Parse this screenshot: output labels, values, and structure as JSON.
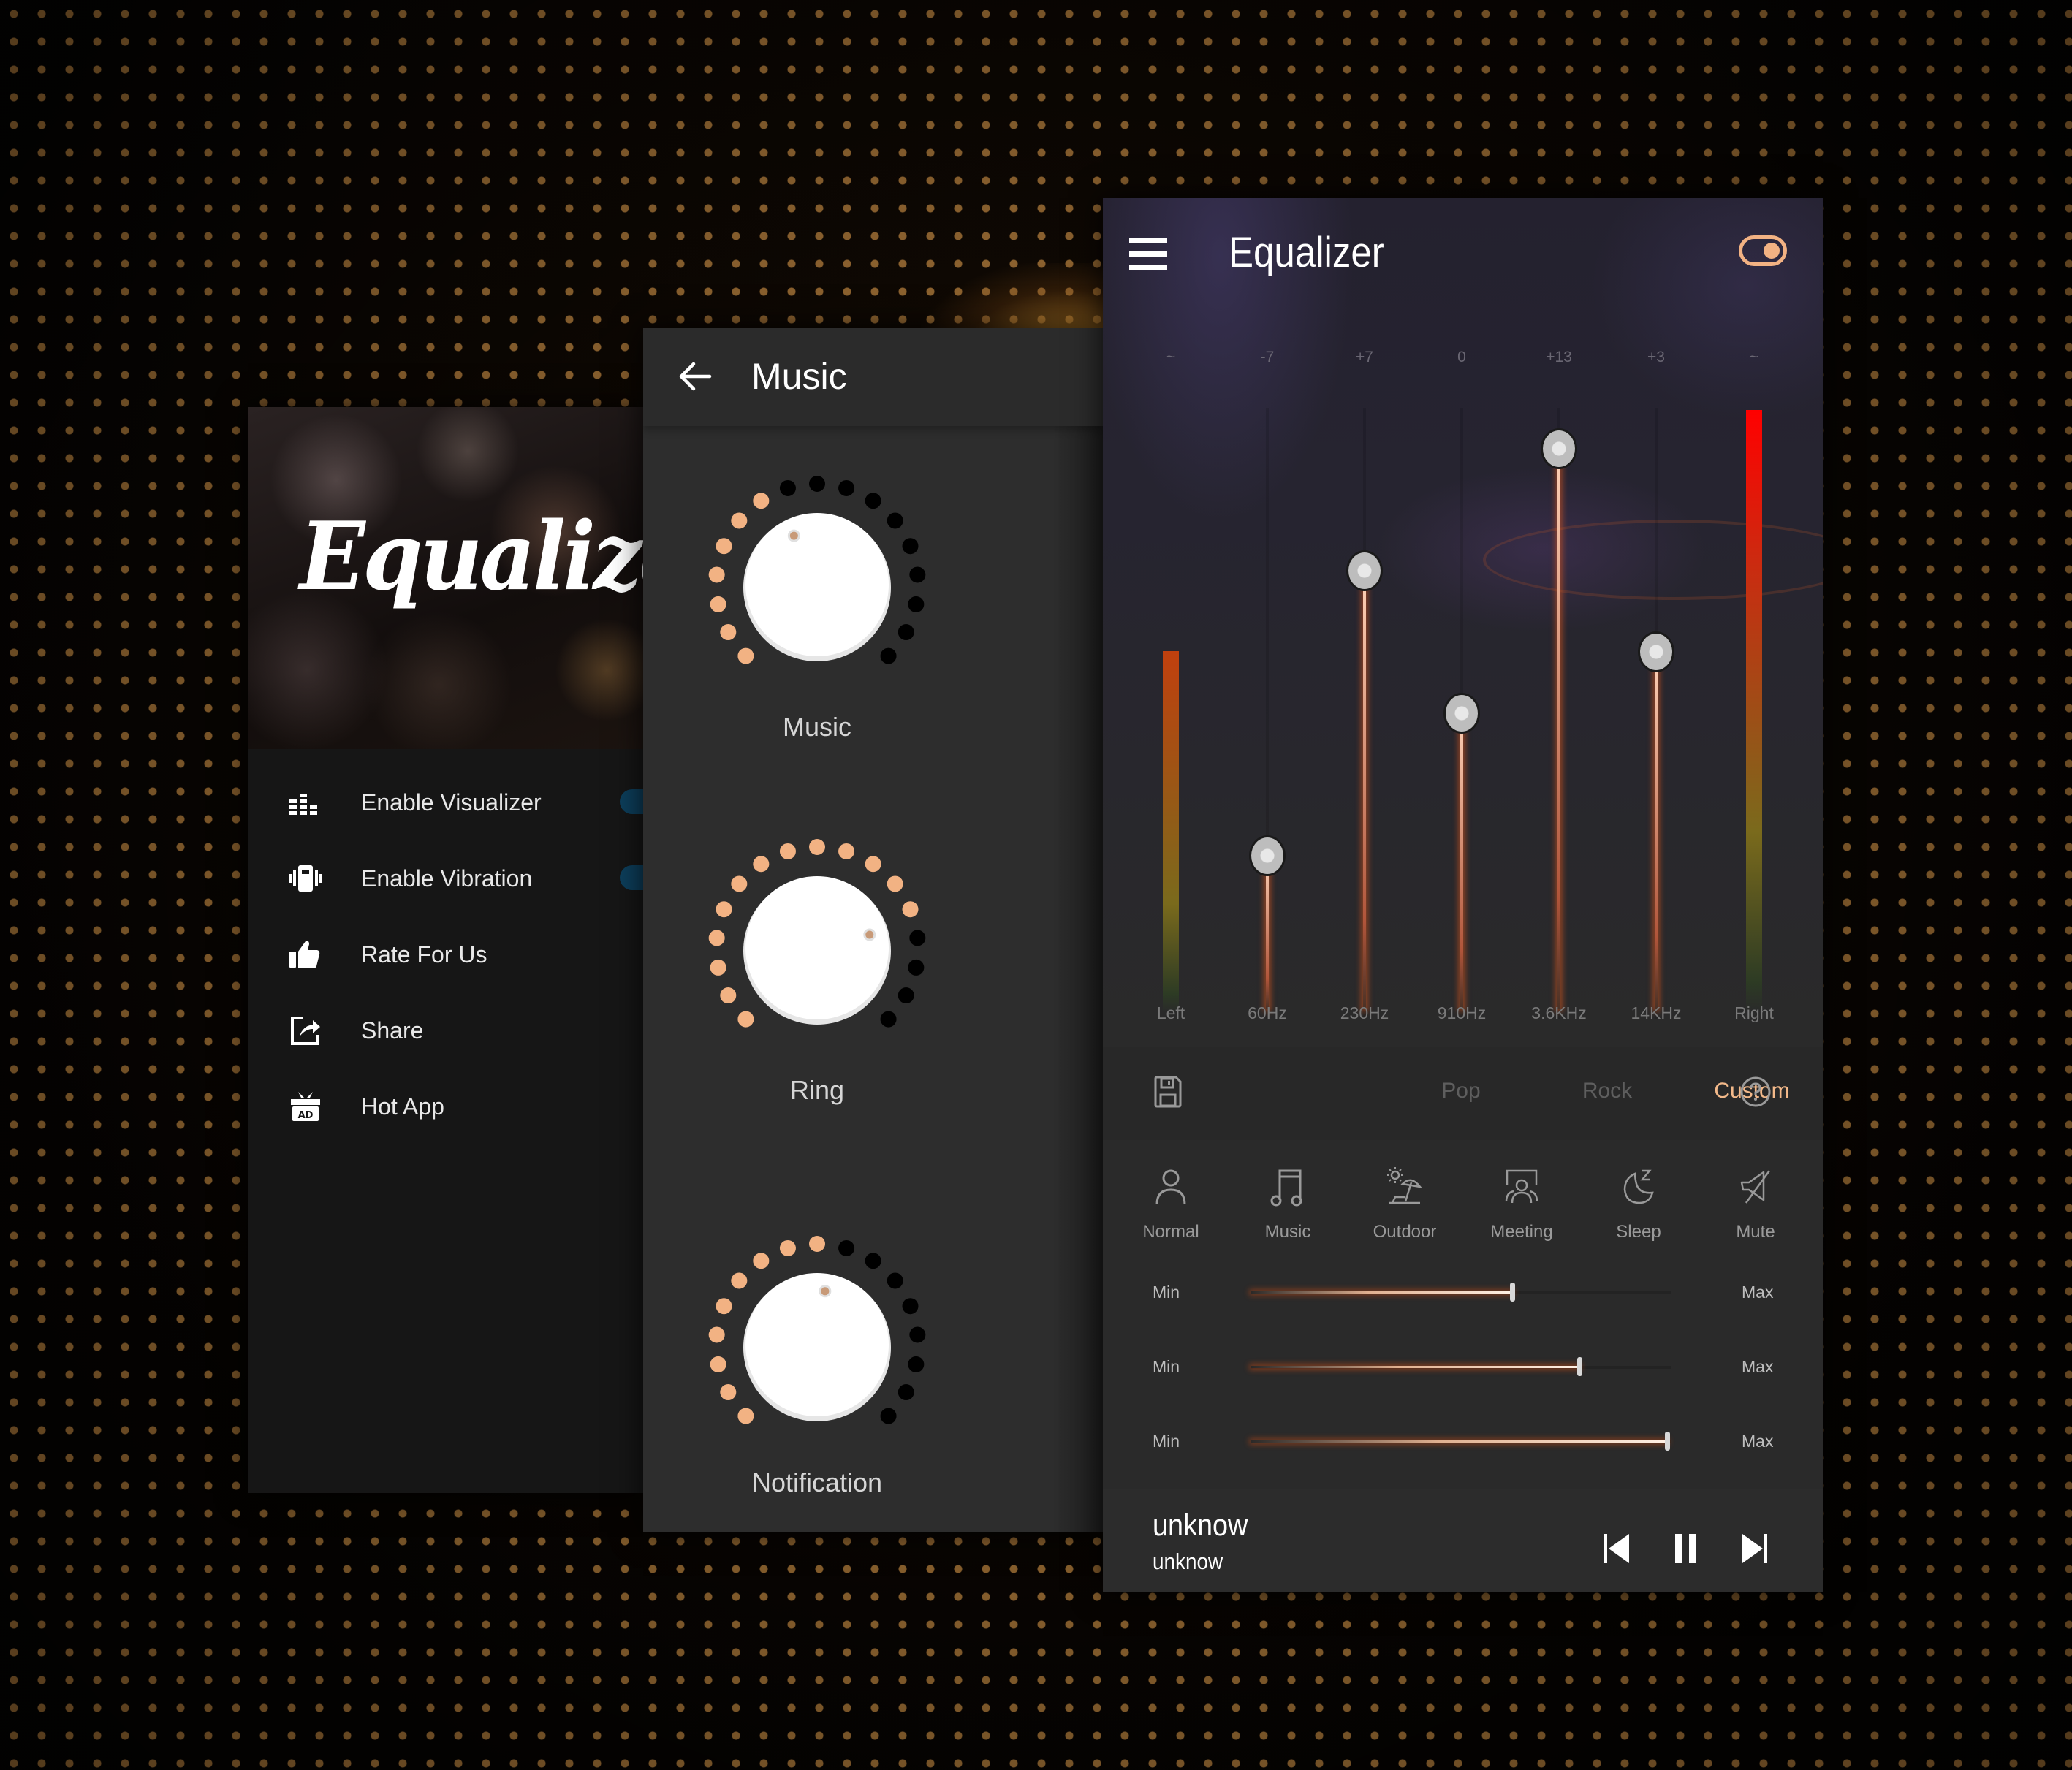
{
  "colors": {
    "accent": "#f2b283",
    "knob_on": "#f2b283",
    "knob_off": "#000000",
    "toggle_blue": "#0d3f5c",
    "vu_top": "#ff0000",
    "vu_bottom": "#2d3b24"
  },
  "left_panel": {
    "hero_title": "Equalizer",
    "menu": [
      {
        "icon": "visualizer-icon",
        "label": "Enable Visualizer",
        "toggle": true
      },
      {
        "icon": "vibration-icon",
        "label": "Enable Vibration",
        "toggle": true
      },
      {
        "icon": "thumbs-up-icon",
        "label": "Rate For Us"
      },
      {
        "icon": "share-icon",
        "label": "Share"
      },
      {
        "icon": "gift-ad-icon",
        "label": "Hot App"
      }
    ]
  },
  "middle_panel": {
    "title": "Music",
    "back_icon": "arrow-left-icon",
    "knob_total_dots": 17,
    "knobs": [
      {
        "label": "Music",
        "level_dots": 7
      },
      {
        "label": "Ring",
        "level_dots": 13
      },
      {
        "label": "Notification",
        "level_dots": 9
      }
    ]
  },
  "equalizer": {
    "title": "Equalizer",
    "menu_icon": "hamburger-icon",
    "power_toggle": "on",
    "gain_range_db": [
      -15,
      15
    ],
    "vu_left": {
      "label": "Left",
      "value_label": "~",
      "level": 0.6
    },
    "vu_right": {
      "label": "Right",
      "value_label": "~",
      "level": 1.0
    },
    "bands": [
      {
        "freq": "60Hz",
        "value_label": "-7",
        "gain_db": -7
      },
      {
        "freq": "230Hz",
        "value_label": "+7",
        "gain_db": 7
      },
      {
        "freq": "910Hz",
        "value_label": "0",
        "gain_db": 0
      },
      {
        "freq": "3.6KHz",
        "value_label": "+13",
        "gain_db": 13
      },
      {
        "freq": "14KHz",
        "value_label": "+3",
        "gain_db": 3
      }
    ],
    "presets": {
      "save_icon": "floppy-disk-icon",
      "help_icon": "question-circle-icon",
      "tabs": [
        {
          "label": "Pop",
          "active": false
        },
        {
          "label": "Rock",
          "active": false
        },
        {
          "label": "Custom",
          "active": true
        }
      ]
    },
    "modes": [
      {
        "icon": "person-icon",
        "label": "Normal"
      },
      {
        "icon": "music-note-icon",
        "label": "Music"
      },
      {
        "icon": "beach-umbrella-icon",
        "label": "Outdoor"
      },
      {
        "icon": "meeting-people-icon",
        "label": "Meeting"
      },
      {
        "icon": "moon-sleep-icon",
        "label": "Sleep"
      },
      {
        "icon": "speaker-mute-icon",
        "label": "Mute"
      }
    ],
    "sliders": [
      {
        "min_label": "Min",
        "max_label": "Max",
        "value": 0.62
      },
      {
        "min_label": "Min",
        "max_label": "Max",
        "value": 0.78
      },
      {
        "min_label": "Min",
        "max_label": "Max",
        "value": 0.99
      }
    ],
    "player": {
      "title": "unknow",
      "artist": "unknow",
      "controls": [
        "skip-previous-icon",
        "pause-icon",
        "skip-next-icon"
      ]
    }
  }
}
